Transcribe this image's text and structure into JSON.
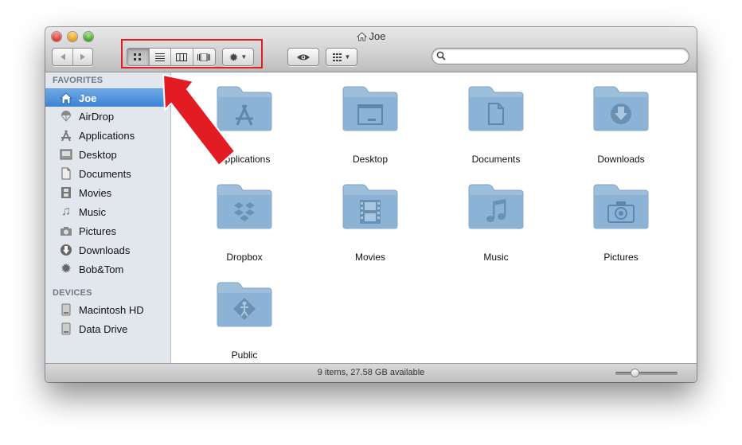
{
  "window": {
    "title": "Joe"
  },
  "toolbar": {
    "view_modes": [
      "icon-view",
      "list-view",
      "column-view",
      "coverflow-view"
    ],
    "active_view": "icon-view"
  },
  "search": {
    "value": "",
    "placeholder": ""
  },
  "sidebar": {
    "favorites_heading": "FAVORITES",
    "favorites": [
      {
        "label": "Joe",
        "icon": "home-icon",
        "selected": true
      },
      {
        "label": "AirDrop",
        "icon": "airdrop-icon"
      },
      {
        "label": "Applications",
        "icon": "applications-icon"
      },
      {
        "label": "Desktop",
        "icon": "desktop-icon"
      },
      {
        "label": "Documents",
        "icon": "document-icon"
      },
      {
        "label": "Movies",
        "icon": "film-icon"
      },
      {
        "label": "Music",
        "icon": "music-note-icon"
      },
      {
        "label": "Pictures",
        "icon": "camera-icon"
      },
      {
        "label": "Downloads",
        "icon": "download-icon"
      },
      {
        "label": "Bob&Tom",
        "icon": "gear-icon"
      }
    ],
    "devices_heading": "DEVICES",
    "devices": [
      {
        "label": "Macintosh HD",
        "icon": "hard-drive-icon"
      },
      {
        "label": "Data Drive",
        "icon": "hard-drive-icon"
      }
    ]
  },
  "folders": [
    {
      "label": "Applications",
      "icon": "applications-icon"
    },
    {
      "label": "Desktop",
      "icon": "desktop-icon"
    },
    {
      "label": "Documents",
      "icon": "document-icon"
    },
    {
      "label": "Downloads",
      "icon": "download-icon"
    },
    {
      "label": "Dropbox",
      "icon": "dropbox-icon"
    },
    {
      "label": "Movies",
      "icon": "film-icon"
    },
    {
      "label": "Music",
      "icon": "music-note-icon"
    },
    {
      "label": "Pictures",
      "icon": "camera-icon"
    },
    {
      "label": "Public",
      "icon": "public-icon"
    }
  ],
  "status": {
    "text": "9 items, 27.58 GB available",
    "icon_size_level": 0.28
  },
  "colors": {
    "annotation": "#e31b23",
    "selection": "#3d83d5",
    "folder": "#8fb5d6"
  }
}
